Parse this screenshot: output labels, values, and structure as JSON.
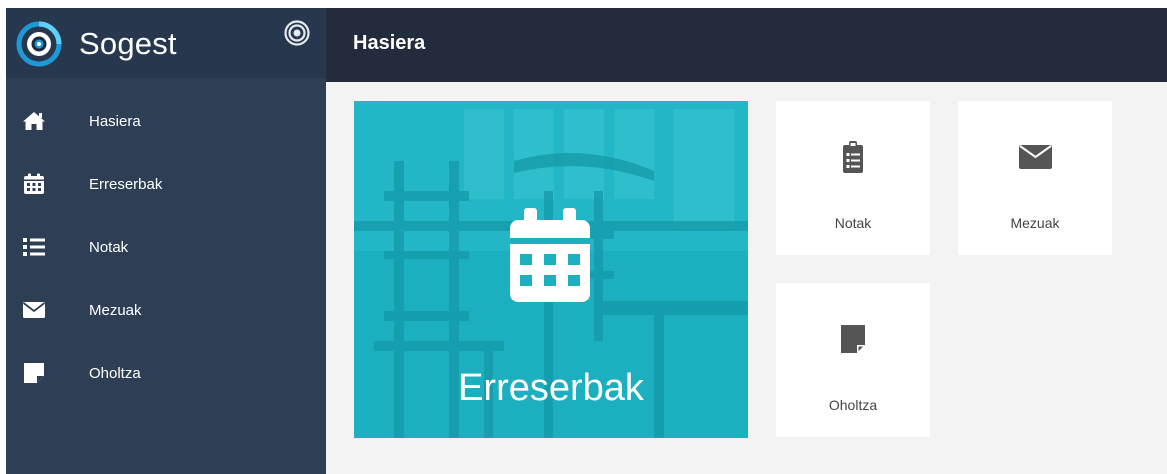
{
  "brand": {
    "name": "Sogest"
  },
  "header": {
    "title": "Hasiera"
  },
  "sidebar": {
    "items": [
      {
        "label": "Hasiera",
        "icon": "home-icon"
      },
      {
        "label": "Erreserbak",
        "icon": "calendar-icon"
      },
      {
        "label": "Notak",
        "icon": "list-icon"
      },
      {
        "label": "Mezuak",
        "icon": "envelope-icon"
      },
      {
        "label": "Oholtza",
        "icon": "sticky-note-icon"
      }
    ]
  },
  "main": {
    "hero": {
      "label": "Erreserbak",
      "icon": "calendar-icon"
    },
    "tiles": [
      {
        "label": "Notak",
        "icon": "clipboard-icon"
      },
      {
        "label": "Mezuak",
        "icon": "envelope-icon"
      },
      {
        "label": "Oholtza",
        "icon": "sticky-note-icon"
      }
    ]
  },
  "colors": {
    "sidebar": "#2d3e55",
    "topbar": "#222c3c",
    "accent": "#1cb0c0",
    "background": "#f3f3f3"
  }
}
